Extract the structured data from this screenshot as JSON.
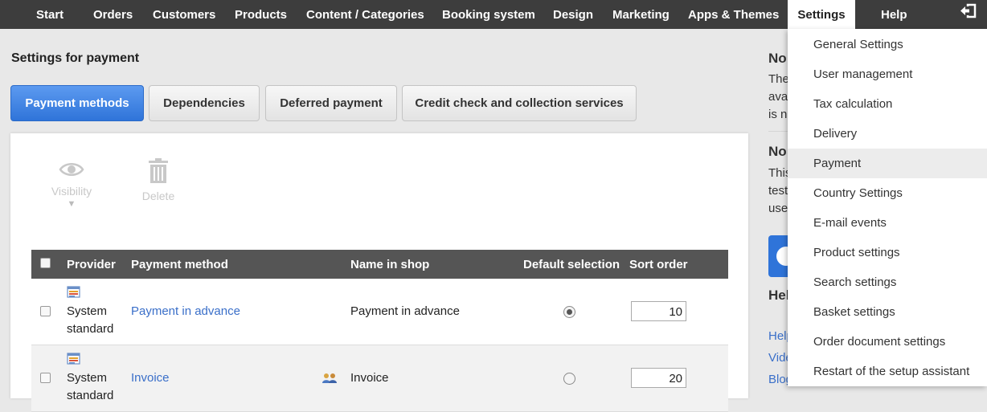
{
  "nav": {
    "items": [
      {
        "label": "Start"
      },
      {
        "label": "Orders"
      },
      {
        "label": "Customers"
      },
      {
        "label": "Products"
      },
      {
        "label": "Content / Categories"
      },
      {
        "label": "Booking system"
      },
      {
        "label": "Design"
      },
      {
        "label": "Marketing"
      },
      {
        "label": "Apps & Themes"
      },
      {
        "label": "Settings"
      },
      {
        "label": "Help"
      }
    ],
    "active": "Settings",
    "logout_icon": "logout-icon"
  },
  "page": {
    "title": "Settings for payment"
  },
  "tabs": [
    {
      "label": "Payment methods",
      "active": true
    },
    {
      "label": "Dependencies",
      "active": false
    },
    {
      "label": "Deferred payment",
      "active": false
    },
    {
      "label": "Credit check and collection services",
      "active": false
    }
  ],
  "toolbar": {
    "visibility_label": "Visibility",
    "visibility_caret": "▼",
    "delete_label": "Delete"
  },
  "table": {
    "headers": {
      "provider": "Provider",
      "method": "Payment method",
      "shop_name": "Name in shop",
      "default": "Default selection",
      "sort": "Sort order"
    },
    "rows": [
      {
        "provider_line1": "System",
        "provider_line2": "standard",
        "method": "Payment in advance",
        "shop_name": "Payment in advance",
        "default": true,
        "sort": "10"
      },
      {
        "provider_line1": "System",
        "provider_line2": "standard",
        "method": "Invoice",
        "shop_name": "Invoice",
        "default": false,
        "sort": "20"
      }
    ]
  },
  "sidebar": {
    "head1": "No",
    "text1": [
      "The",
      "ava",
      "is n"
    ],
    "head2": "No",
    "text2": [
      "This",
      "test",
      "use"
    ],
    "head3": "Hel",
    "links": [
      "Help",
      "Vide",
      "Blog"
    ]
  },
  "dropdown": {
    "items": [
      "General Settings",
      "User management",
      "Tax calculation",
      "Delivery",
      "Payment",
      "Country Settings",
      "E-mail events",
      "Product settings",
      "Search settings",
      "Basket settings",
      "Order document settings",
      "Restart of the setup assistant"
    ],
    "highlighted": "Payment"
  },
  "colors": {
    "nav_bg": "#3d3d3d",
    "accent": "#2f74d9",
    "link": "#3a6fc9",
    "table_head": "#555555"
  }
}
